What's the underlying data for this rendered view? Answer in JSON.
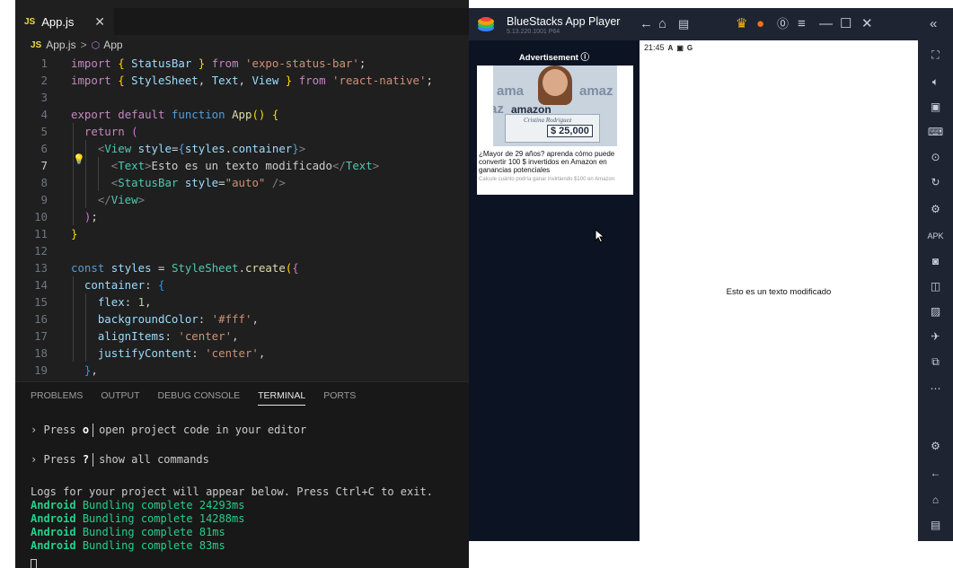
{
  "editor": {
    "tab_label": "App.js",
    "tab_icon": "JS",
    "tab_close": "✕",
    "breadcrumb": {
      "file": "App.js",
      "separator": ">",
      "symbol": "App"
    },
    "current_line": 7
  },
  "panel": {
    "tabs": [
      "PROBLEMS",
      "OUTPUT",
      "DEBUG CONSOLE",
      "TERMINAL",
      "PORTS"
    ],
    "active_tab": "TERMINAL",
    "terminal": {
      "press_o_key": "o",
      "press_o_text": "open project code in your editor",
      "press_help_key": "?",
      "press_help_text": "show all commands",
      "prompt": "›",
      "press_word": "Press",
      "logs_note": "Logs for your project will appear below. Press Ctrl+C to exit.",
      "bundles": [
        {
          "platform": "Android",
          "text": "Bundling complete 24293ms"
        },
        {
          "platform": "Android",
          "text": "Bundling complete 14288ms"
        },
        {
          "platform": "Android",
          "text": "Bundling complete 81ms"
        },
        {
          "platform": "Android",
          "text": "Bundling complete 83ms"
        }
      ]
    }
  },
  "bluestacks": {
    "title": "BlueStacks App Player",
    "version": "5.13.220.1001 P64",
    "ad": {
      "label": "Advertisement ⓘ",
      "headline": "¿Mayor de 29 años? aprenda cómo puede convertir 100 $ invertidos en Amazon en ganancias potenciales",
      "subtext": "Calcule cuánto podría ganar invirtiendo $100 en Amazon",
      "image_brand": "amazon",
      "image_signer": "Cristina Rodriguez",
      "image_amount": "$ 25,000"
    },
    "phone": {
      "time": "21:45",
      "status_icons": [
        "A",
        "▣",
        "G"
      ],
      "app_text": "Esto es un texto modificado"
    }
  },
  "colors": {
    "editor_bg": "#1f1f1f",
    "panel_bg": "#181818",
    "bluestacks_chrome": "#1e2432",
    "ad_pane": "#0c1424",
    "terminal_green": "#23d18b"
  }
}
